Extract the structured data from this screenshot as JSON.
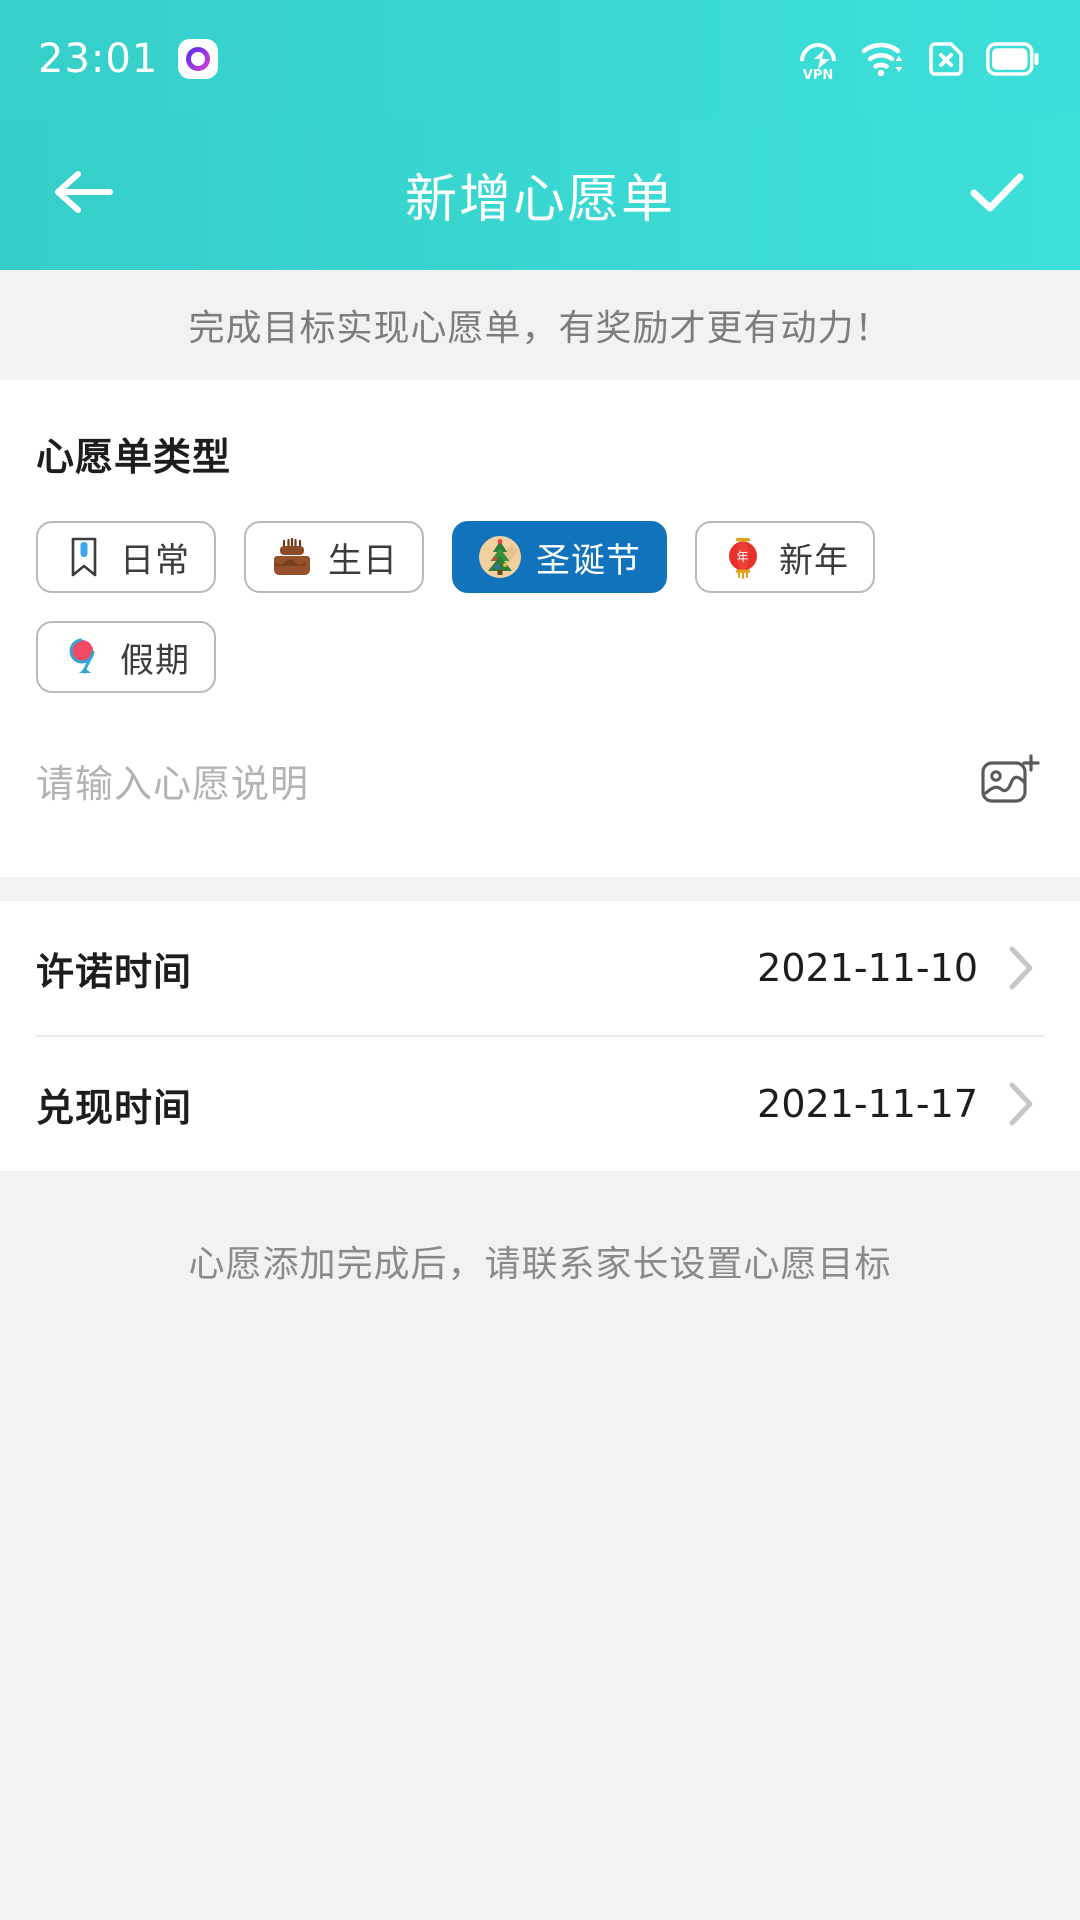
{
  "statusbar": {
    "time": "23:01",
    "app_badge_icon": "app-ring-icon",
    "icons": [
      "vpn-icon",
      "wifi-icon",
      "sim-card-disabled-icon",
      "battery-icon"
    ]
  },
  "header": {
    "back_icon": "back-arrow-icon",
    "title": "新增心愿单",
    "confirm_icon": "check-icon",
    "gradient_from": "#35cec9",
    "gradient_to": "#3ee0da"
  },
  "banner": {
    "text": "完成目标实现心愿单，有奖励才更有动力！"
  },
  "type_section": {
    "title": "心愿单类型",
    "selected_color": "#1273bd",
    "chips": [
      {
        "label": "日常",
        "icon": "bookmark-icon",
        "selected": false
      },
      {
        "label": "生日",
        "icon": "birthday-cake-icon",
        "selected": false
      },
      {
        "label": "圣诞节",
        "icon": "christmas-tree-icon",
        "selected": true
      },
      {
        "label": "新年",
        "icon": "red-lantern-icon",
        "selected": false
      },
      {
        "label": "假期",
        "icon": "globe-icon",
        "selected": false
      }
    ]
  },
  "wish_input": {
    "value": "",
    "placeholder": "请输入心愿说明",
    "add_image_icon": "add-image-icon"
  },
  "date_rows": [
    {
      "label": "许诺时间",
      "value": "2021-11-10",
      "chevron": "chevron-right-icon"
    },
    {
      "label": "兑现时间",
      "value": "2021-11-17",
      "chevron": "chevron-right-icon"
    }
  ],
  "footer": {
    "hint": "心愿添加完成后，请联系家长设置心愿目标"
  }
}
